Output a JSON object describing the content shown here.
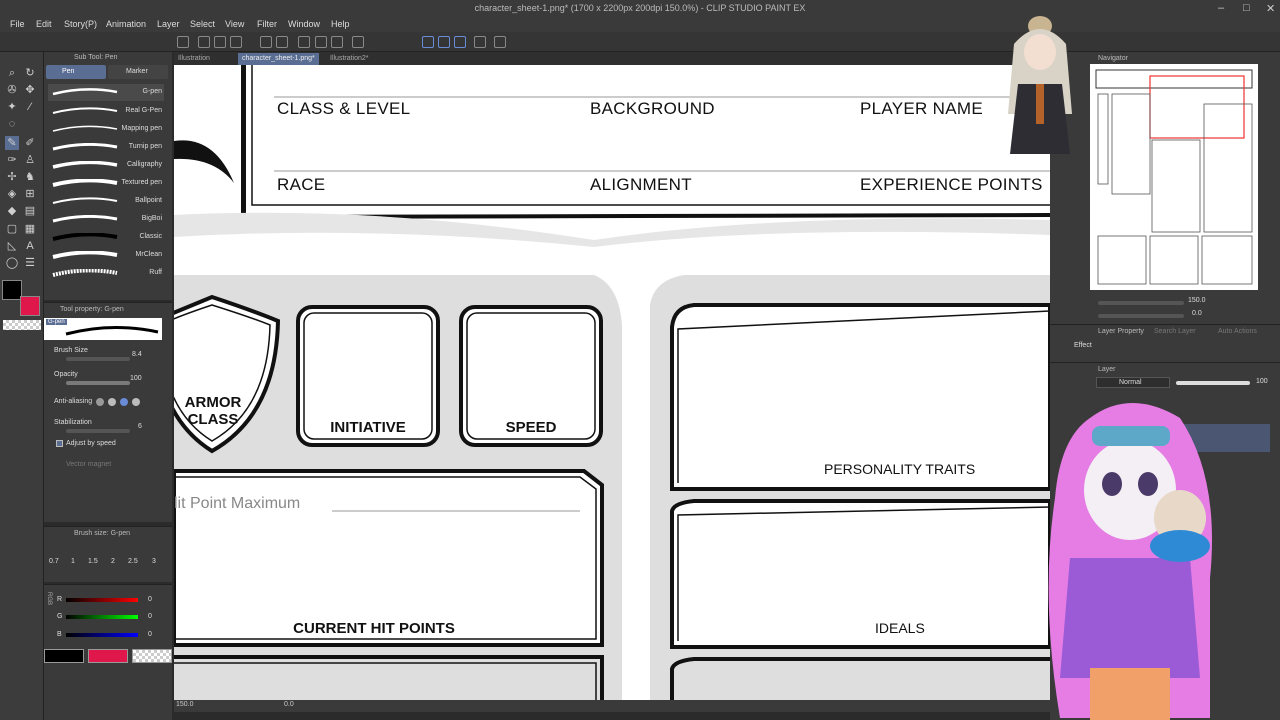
{
  "app": {
    "title": "character_sheet-1.png* (1700 x 2200px 200dpi 150.0%) - CLIP STUDIO PAINT EX",
    "window_controls": [
      "–",
      "□",
      "✕"
    ]
  },
  "menu": [
    "File",
    "Edit",
    "Story(P)",
    "Animation",
    "Layer",
    "Select",
    "View",
    "Filter",
    "Window",
    "Help"
  ],
  "tabs": [
    {
      "label": "Illustration"
    },
    {
      "label": "character_sheet-1.png*",
      "active": true
    },
    {
      "label": "Illustration2*"
    }
  ],
  "subtool": {
    "header": "Sub Tool: Pen",
    "groups": [
      "Pen",
      "Marker"
    ],
    "brushes": [
      "G-pen",
      "Real G-Pen",
      "Mapping pen",
      "Turnip pen",
      "Calligraphy",
      "Textured pen",
      "Ballpoint",
      "BigBoi",
      "Classic",
      "MrClean",
      "Ruff"
    ]
  },
  "tool_property": {
    "header": "Tool property: G-pen",
    "preset": "G-pen",
    "brush_size_label": "Brush Size",
    "brush_size": "8.4",
    "opacity_label": "Opacity",
    "opacity": "100",
    "antialias_label": "Anti-aliasing",
    "stabilization_label": "Stabilization",
    "stabilization": "6",
    "adjust_speed_label": "Adjust by speed",
    "vector_magnet_label": "Vector magnet"
  },
  "brush_size_panel": {
    "header": "Brush size: G-pen",
    "sizes": [
      "0.7",
      "1",
      "1.5",
      "2",
      "2.5",
      "3"
    ]
  },
  "color": {
    "labels": [
      "R",
      "G",
      "B"
    ],
    "values": [
      "0",
      "0",
      "0"
    ],
    "mode_label": "RGB",
    "main": "#000000",
    "sub": "#e0174a"
  },
  "navigator": {
    "header": "Navigator",
    "zoom": "150.0",
    "rotation": "0.0"
  },
  "layer_panel": {
    "tabs": [
      "Layer Property",
      "Search Layer",
      "Auto Actions"
    ],
    "effect_label": "Effect",
    "layer_tab": "Layer",
    "blend_mode": "Normal",
    "opacity": "100"
  },
  "status": {
    "zoom": "150.0",
    "angle": "0.0"
  },
  "sheet": {
    "class_level": "CLASS & LEVEL",
    "background": "BACKGROUND",
    "player_name": "PLAYER NAME",
    "race": "RACE",
    "alignment": "ALIGNMENT",
    "experience": "EXPERIENCE POINTS",
    "armor_class_1": "ARMOR",
    "armor_class_2": "CLASS",
    "initiative": "INITIATIVE",
    "speed": "SPEED",
    "hp_max": "lit Point Maximum",
    "current_hp": "CURRENT HIT POINTS",
    "personality": "PERSONALITY TRAITS",
    "ideals": "IDEALS"
  }
}
